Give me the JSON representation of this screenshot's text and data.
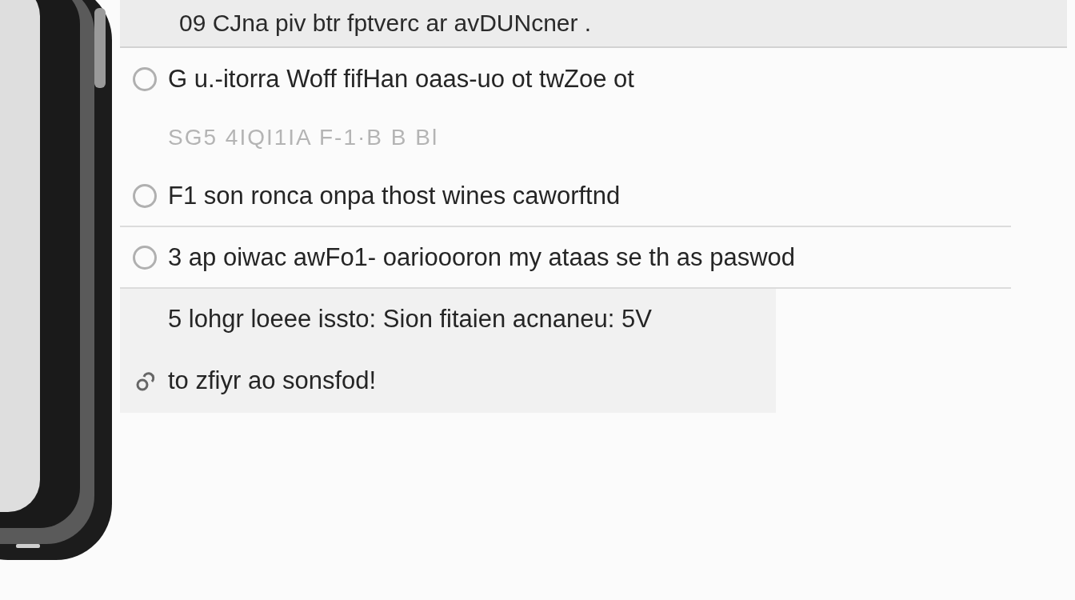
{
  "header": {
    "text": "09 CJna piv btr fptverc ar avDUNcner ."
  },
  "items": [
    {
      "kind": "radio",
      "text": "G u.-itorra Woff fifHan oaas-uo ot twZoe ot",
      "selected": false,
      "divider": false
    },
    {
      "kind": "faded",
      "text": "SG5 4IQI1IA F-1·B B Bl"
    },
    {
      "kind": "radio",
      "text": "F1 son ronca onpa thost wines caworftnd",
      "selected": false,
      "divider": true
    },
    {
      "kind": "radio",
      "text": "3 ap oiwac awFo1- oarioooron my ataas se th as paswod",
      "selected": false,
      "divider": true
    },
    {
      "kind": "shaded",
      "text": "5 lohgr loeee issto: Sion fitaien acnaneu: 5V"
    },
    {
      "kind": "shaded-icon",
      "text": "to zfiyr ao sonsfod!"
    }
  ]
}
